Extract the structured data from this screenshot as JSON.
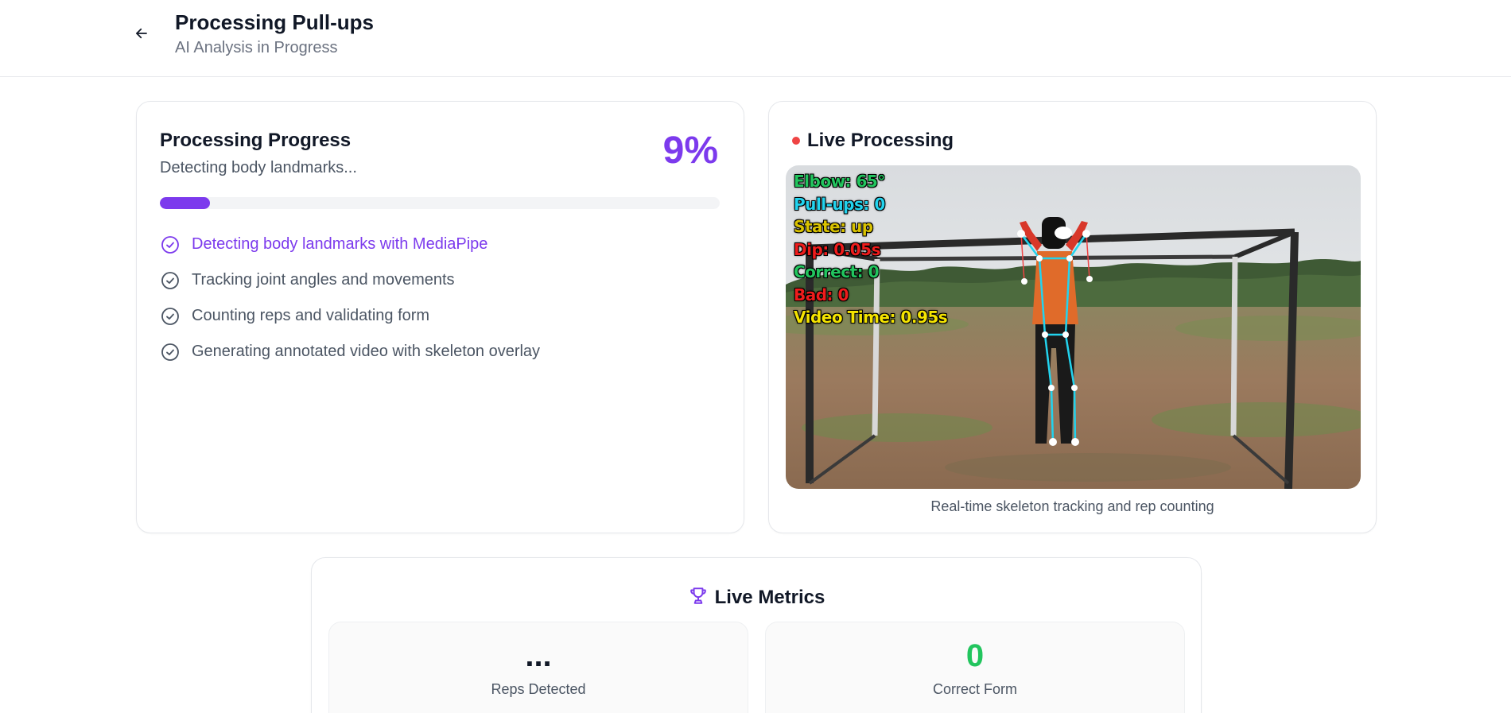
{
  "header": {
    "title": "Processing Pull-ups",
    "subtitle": "AI Analysis in Progress",
    "back_icon": "arrow-left-icon"
  },
  "progress": {
    "title": "Processing Progress",
    "status": "Detecting body landmarks...",
    "percent_label": "9%",
    "percent": 9,
    "accent_color": "#7c3aed",
    "steps": [
      {
        "label": "Detecting body landmarks with MediaPipe",
        "active": true
      },
      {
        "label": "Tracking joint angles and movements",
        "active": false
      },
      {
        "label": "Counting reps and validating form",
        "active": false
      },
      {
        "label": "Generating annotated video with skeleton overlay",
        "active": false
      }
    ]
  },
  "live": {
    "title": "Live Processing",
    "indicator_color": "#ef4444",
    "caption": "Real-time skeleton tracking and rep counting",
    "overlay": [
      {
        "text": "Elbow: 65°",
        "color": "#22c55e"
      },
      {
        "text": "Pull-ups: 0",
        "color": "#22d3ee"
      },
      {
        "text": "State: up",
        "color": "#d9c200"
      },
      {
        "text": "Dip: 0.05s",
        "color": "#ef1c1c"
      },
      {
        "text": "Correct: 0",
        "color": "#22c55e"
      },
      {
        "text": "Bad: 0",
        "color": "#ef1c1c"
      },
      {
        "text": "Video Time: 0.95s",
        "color": "#f5e400"
      }
    ]
  },
  "metrics": {
    "title": "Live Metrics",
    "icon": "trophy-icon",
    "reps": {
      "value": "...",
      "label": "Reps Detected"
    },
    "correct": {
      "value": "0",
      "label": "Correct Form",
      "color": "#22c55e"
    }
  }
}
